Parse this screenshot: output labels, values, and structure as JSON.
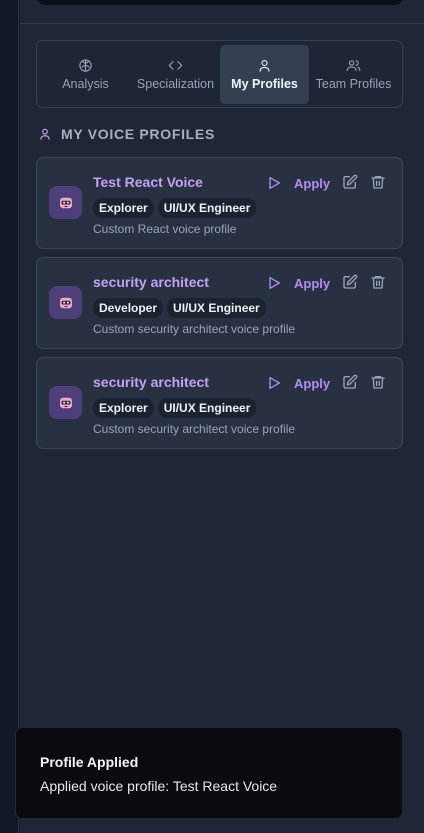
{
  "tabs": [
    {
      "label": "Analysis",
      "icon": "brain-icon"
    },
    {
      "label": "Specialization",
      "icon": "code-icon"
    },
    {
      "label": "My Profiles",
      "icon": "user-icon",
      "active": true
    },
    {
      "label": "Team Profiles",
      "icon": "users-icon"
    }
  ],
  "section": {
    "title": "MY VOICE PROFILES",
    "icon": "user-icon"
  },
  "profiles": [
    {
      "name": "Test React Voice",
      "badges": [
        "Explorer",
        "UI/UX Engineer"
      ],
      "description": "Custom React voice profile",
      "apply_label": "Apply"
    },
    {
      "name": "security architect",
      "badges": [
        "Developer",
        "UI/UX Engineer"
      ],
      "description": "Custom security architect voice profile",
      "apply_label": "Apply"
    },
    {
      "name": "security architect",
      "badges": [
        "Explorer",
        "UI/UX Engineer"
      ],
      "description": "Custom security architect voice profile",
      "apply_label": "Apply"
    }
  ],
  "toast": {
    "title": "Profile Applied",
    "message": "Applied voice profile: Test React Voice"
  },
  "colors": {
    "accent": "#b58cf2",
    "panel": "#1f2736",
    "card": "#273142",
    "toast": "#0a0c11"
  }
}
